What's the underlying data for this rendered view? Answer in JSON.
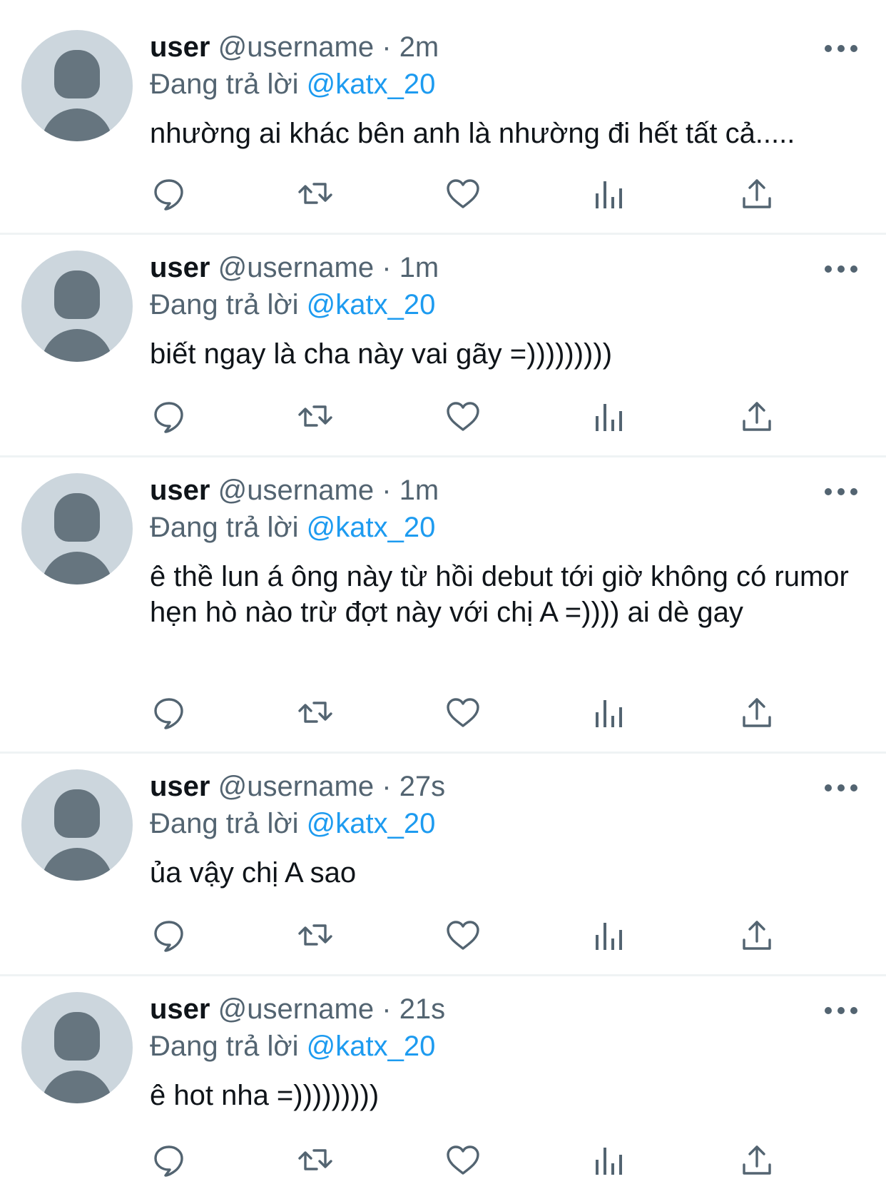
{
  "colors": {
    "mention": "#1d9bf0",
    "secondary_text": "#536471",
    "primary_text": "#0f1419",
    "avatar_bg": "#ccd6dd",
    "avatar_fg": "#66757f"
  },
  "icons": {
    "reply": "speech-bubble-icon",
    "retweet": "retweet-arrows-icon",
    "like": "heart-icon",
    "views": "bar-chart-icon",
    "share": "share-upload-icon",
    "more": "three-dots-icon"
  },
  "tweets": [
    {
      "display_name": "user",
      "handle": "@username",
      "separator": "·",
      "time": "2m",
      "reply_prefix": "Đang trả lời",
      "reply_to": "@katx_20",
      "text": "nhường ai khác bên anh là nhường đi hết tất cả....."
    },
    {
      "display_name": "user",
      "handle": "@username",
      "separator": "·",
      "time": "1m",
      "reply_prefix": "Đang trả lời",
      "reply_to": "@katx_20",
      "text": "biết ngay là cha này vai gãy =)))))))))"
    },
    {
      "display_name": "user",
      "handle": "@username",
      "separator": "·",
      "time": "1m",
      "reply_prefix": "Đang trả lời",
      "reply_to": "@katx_20",
      "text": "ê thề lun á ông này từ hồi debut tới giờ không có rumor hẹn hò nào trừ đợt này với chị A =)))) ai dè gay"
    },
    {
      "display_name": "user",
      "handle": "@username",
      "separator": "·",
      "time": "27s",
      "reply_prefix": "Đang trả lời",
      "reply_to": "@katx_20",
      "text": "ủa vậy chị A sao"
    },
    {
      "display_name": "user",
      "handle": "@username",
      "separator": "·",
      "time": "21s",
      "reply_prefix": "Đang trả lời",
      "reply_to": "@katx_20",
      "text": "ê hot nha =)))))))))"
    }
  ]
}
